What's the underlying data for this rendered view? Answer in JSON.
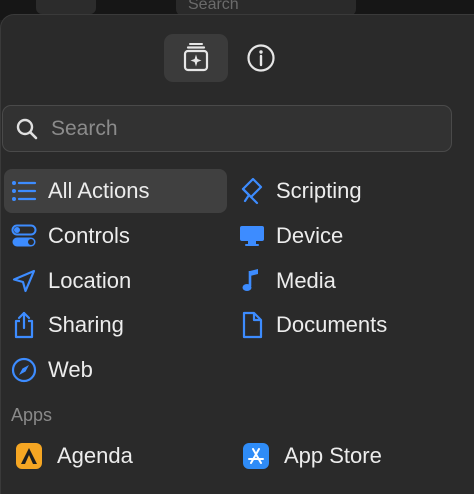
{
  "toolbar_ghost": {
    "search_label": "Search"
  },
  "tabs": [
    {
      "name": "library",
      "icon": "sparkle-stack-icon",
      "active": true
    },
    {
      "name": "info",
      "icon": "info-icon",
      "active": false
    }
  ],
  "search": {
    "placeholder": "Search",
    "value": ""
  },
  "categories": [
    {
      "label": "All Actions",
      "icon": "list-icon",
      "selected": true
    },
    {
      "label": "Scripting",
      "icon": "scripting-icon",
      "selected": false
    },
    {
      "label": "Controls",
      "icon": "toggles-icon",
      "selected": false
    },
    {
      "label": "Device",
      "icon": "display-icon",
      "selected": false
    },
    {
      "label": "Location",
      "icon": "location-arrow-icon",
      "selected": false
    },
    {
      "label": "Media",
      "icon": "music-note-icon",
      "selected": false
    },
    {
      "label": "Sharing",
      "icon": "share-icon",
      "selected": false
    },
    {
      "label": "Documents",
      "icon": "document-icon",
      "selected": false
    },
    {
      "label": "Web",
      "icon": "compass-icon",
      "selected": false
    }
  ],
  "apps_section": {
    "title": "Apps",
    "items": [
      {
        "label": "Agenda",
        "icon": "agenda-app-icon"
      },
      {
        "label": "App Store",
        "icon": "app-store-icon"
      }
    ]
  },
  "colors": {
    "accent": "#3d8cff",
    "panel": "#2a2a2a",
    "selected": "#404040"
  }
}
